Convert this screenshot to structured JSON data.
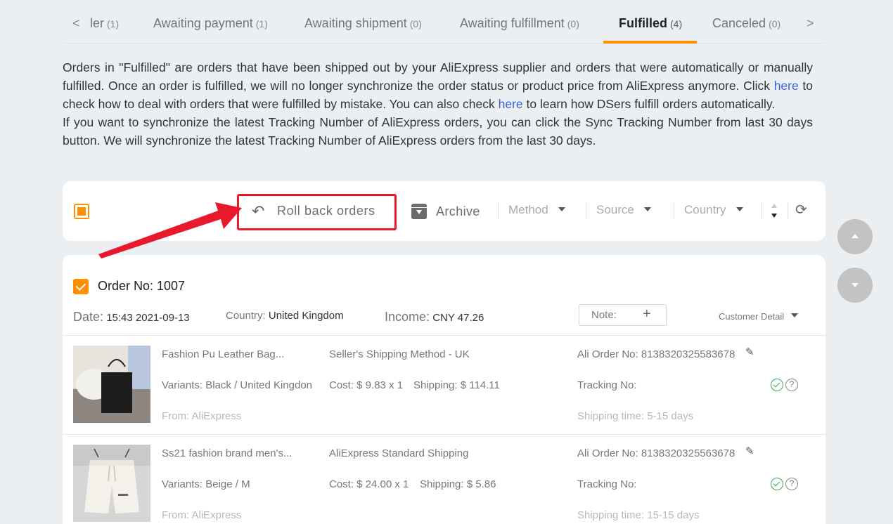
{
  "tabs": [
    {
      "label": "ler",
      "count": "(1)"
    },
    {
      "label": "Awaiting payment",
      "count": "(1)"
    },
    {
      "label": "Awaiting shipment",
      "count": "(0)"
    },
    {
      "label": "Awaiting fulfillment",
      "count": "(0)"
    },
    {
      "label": "Fulfilled",
      "count": "(4)"
    },
    {
      "label": "Canceled",
      "count": "(0)"
    }
  ],
  "tabs_prev": "<",
  "tabs_next": ">",
  "description": {
    "p1_a": "Orders in \"Fulfilled\" are orders that have been shipped out by your AliExpress supplier and orders that were automatically or manually fulfilled. Once an order is fulfilled, we will no longer synchronize the order status or product price from AliExpress anymore. Click ",
    "link1": "here",
    "p1_b": " to check how to deal with orders that were fulfilled by mistake. You can also check ",
    "link2": "here",
    "p1_c": " to learn how DSers fulfill orders automatically.",
    "p2": "If you want to synchronize the latest Tracking Number of AliExpress orders, you can click the Sync Tracking Number from last 30 days button. We will synchronize the latest Tracking Number of AliExpress orders from the last 30 days."
  },
  "toolbar": {
    "rollback_icon": "↶",
    "rollback_label": "Roll back orders",
    "archive_label": "Archive",
    "method": "Method",
    "source": "Source",
    "country": "Country",
    "refresh_icon": "⟳"
  },
  "order": {
    "title": "Order No: 1007",
    "date_key": "Date:",
    "date_val": "15:43 2021-09-13",
    "country_key": "Country:",
    "country_val": "United Kingdom",
    "income_key": "Income:",
    "income_val": "CNY 47.26",
    "note_label": "Note:",
    "note_plus": "+",
    "customer_detail": "Customer Detail",
    "items": [
      {
        "name": "Fashion Pu Leather Bag...",
        "variants": "Variants: Black / United Kingdon",
        "from": "From: AliExpress",
        "shipping_method": "Seller's Shipping Method - UK",
        "cost": "Cost: $ 9.83 x 1",
        "shipping": "Shipping: $ 114.11",
        "ali_order": "Ali Order No: 8138320325583678",
        "tracking": "Tracking No:",
        "shipping_time": "Shipping time: 5-15 days"
      },
      {
        "name": "Ss21 fashion brand men's...",
        "variants": "Variants: Beige / M",
        "from": "From: AliExpress",
        "shipping_method": "AliExpress Standard Shipping",
        "cost": "Cost: $ 24.00 x 1",
        "shipping": "Shipping: $ 5.86",
        "ali_order": "Ali Order No: 8138320325563678",
        "tracking": "Tracking No:",
        "shipping_time": "Shipping time: 15-15 days"
      }
    ]
  },
  "icons": {
    "pencil": "✎",
    "question": "?"
  },
  "colors": {
    "accent": "#ff8f00",
    "highlight_box": "#e8192c",
    "link": "#3a63d6",
    "success": "#3aa856"
  }
}
